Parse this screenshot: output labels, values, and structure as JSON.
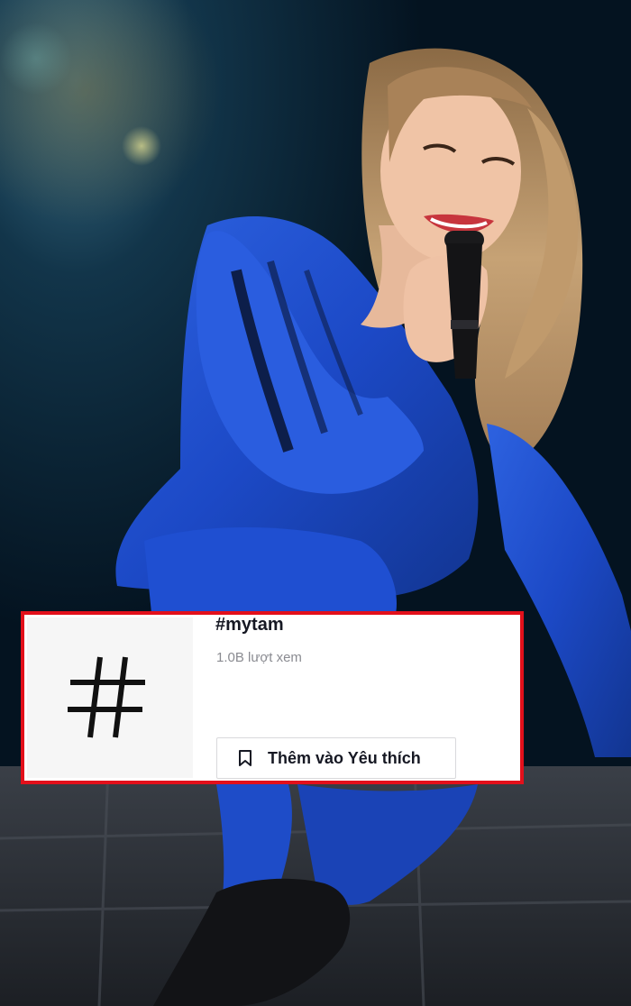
{
  "photo": {
    "subject": "stage-performer-photo",
    "colors": {
      "background": "#061624",
      "outfit": "#1f4fd1",
      "hair": "#b9956a",
      "stage_block": "#2b2f36"
    }
  },
  "hashtag_card": {
    "icon": "hashtag-icon",
    "title": "#mytam",
    "views": "1.0B lượt xem",
    "favorite_button": {
      "icon": "bookmark-icon",
      "label": "Thêm vào Yêu thích"
    },
    "colors": {
      "border": "#e3101b",
      "title": "#161823",
      "meta": "#8a8b91"
    }
  }
}
